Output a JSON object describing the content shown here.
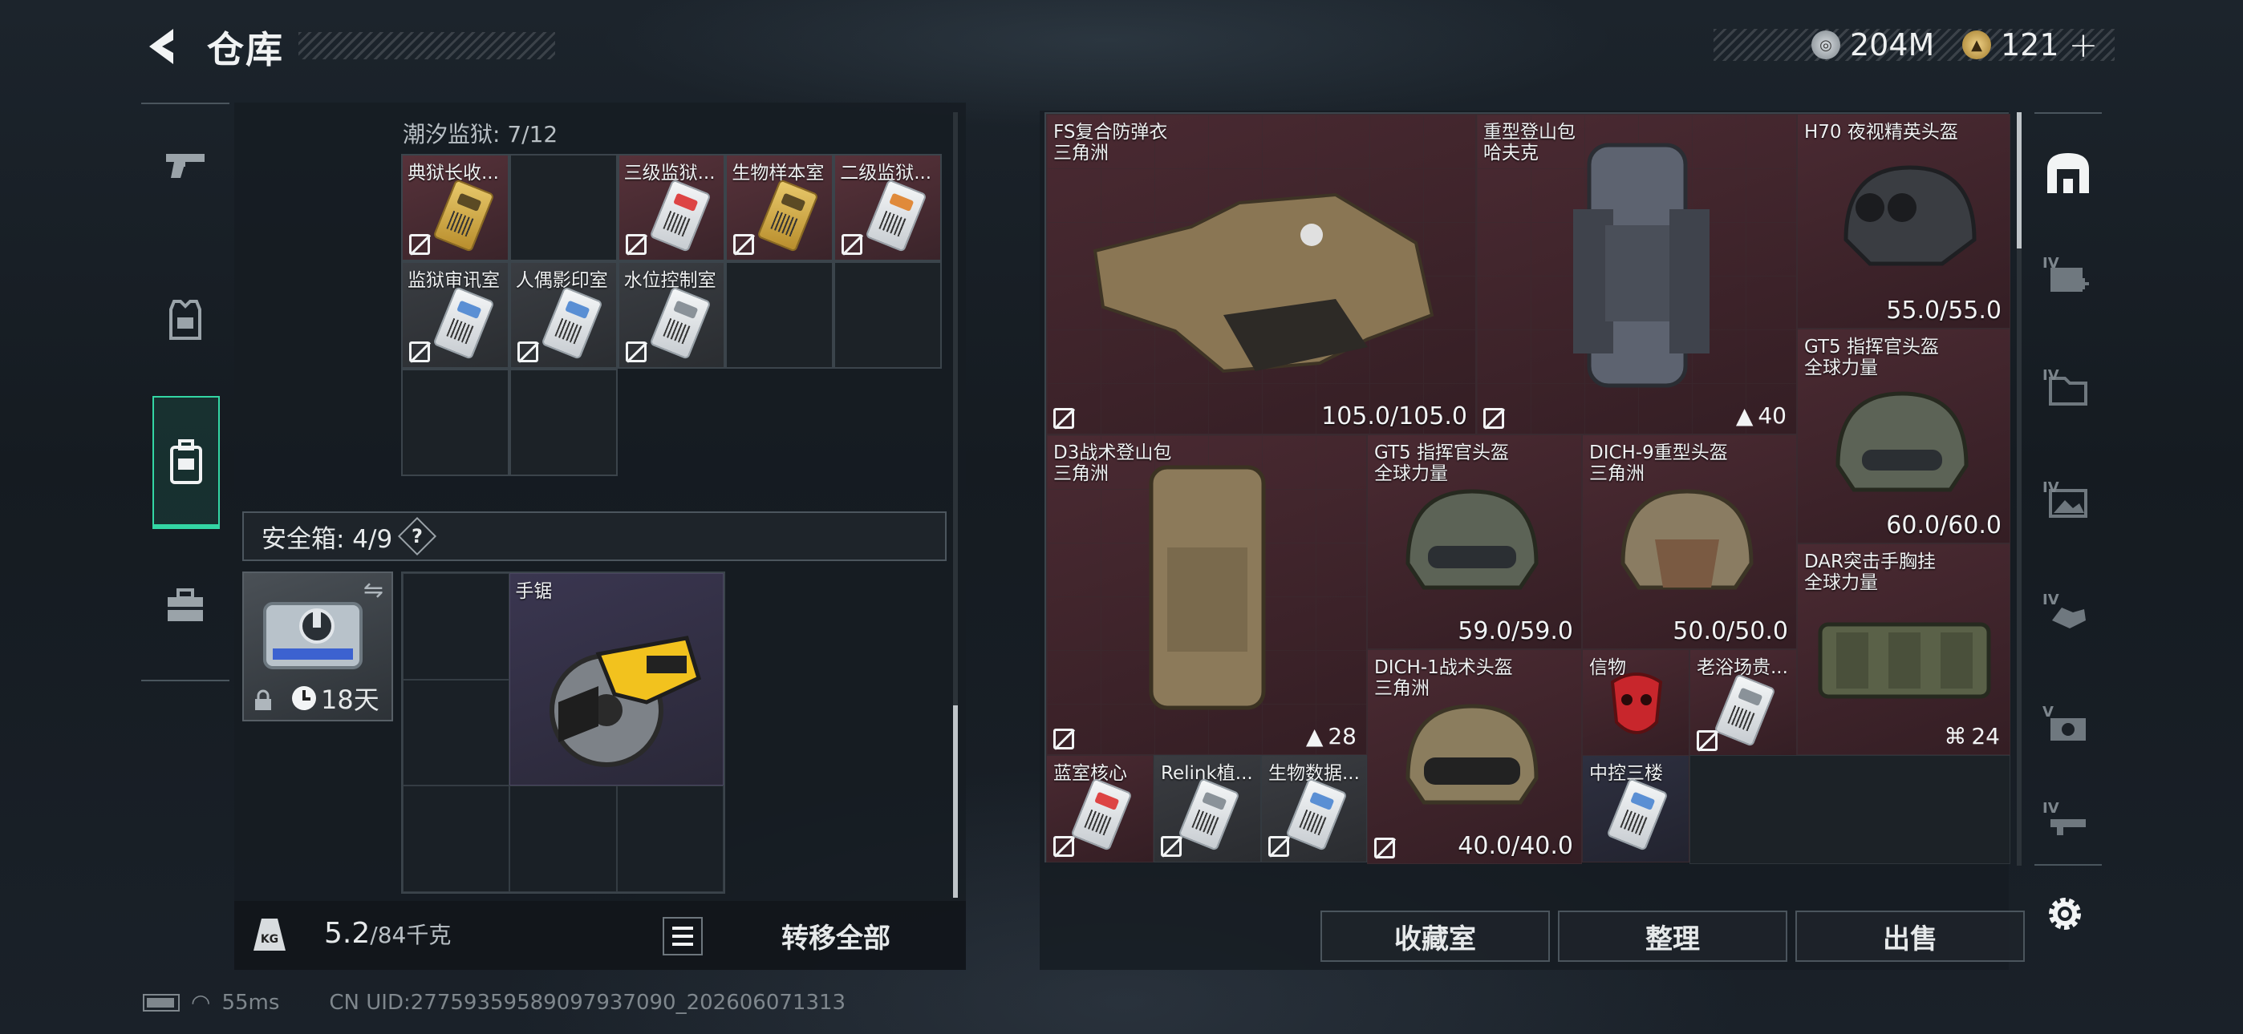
{
  "header": {
    "title": "仓库",
    "silver": "204M",
    "gold": "121"
  },
  "left_nav": [
    {
      "name": "weapons"
    },
    {
      "name": "equipment"
    },
    {
      "name": "backpack"
    },
    {
      "name": "toolbox"
    }
  ],
  "prison_section": {
    "title": "潮汐监狱: 7/12",
    "items": [
      "典狱长收...",
      "三级监狱...",
      "生物样本室",
      "二级监狱...",
      "监狱审讯室",
      "人偶影印室",
      "水位控制室"
    ]
  },
  "safe_box": {
    "label": "安全箱: 4/9",
    "help": "?",
    "timer": "18天",
    "item_name": "手锯"
  },
  "bottom_bar": {
    "weight_icon": "KG",
    "weight_current": "5.2",
    "weight_max": "/84千克",
    "transfer_all": "转移全部"
  },
  "storage": {
    "items": [
      {
        "name": "FS复合防弹衣",
        "origin": "三角洲",
        "value": "105.0/105.0"
      },
      {
        "name": "重型登山包",
        "origin": "哈夫克",
        "value": "40"
      },
      {
        "name": "H70 夜视精英头盔",
        "origin": "",
        "value": "55.0/55.0"
      },
      {
        "name": "GT5 指挥官头盔",
        "origin": "全球力量",
        "value": "60.0/60.0"
      },
      {
        "name": "D3战术登山包",
        "origin": "三角洲",
        "value": "28"
      },
      {
        "name": "GT5 指挥官头盔",
        "origin": "全球力量",
        "value": "59.0/59.0"
      },
      {
        "name": "DICH-9重型头盔",
        "origin": "三角洲",
        "value": "50.0/50.0"
      },
      {
        "name": "DAR突击手胸挂",
        "origin": "全球力量",
        "value": "24"
      },
      {
        "name": "DICH-1战术头盔",
        "origin": "三角洲",
        "value": "40.0/40.0"
      },
      {
        "name": "信物",
        "origin": "",
        "value": ""
      },
      {
        "name": "老浴场贵...",
        "origin": "",
        "value": ""
      },
      {
        "name": "蓝室核心",
        "origin": "",
        "value": ""
      },
      {
        "name": "Relink植...",
        "origin": "",
        "value": ""
      },
      {
        "name": "生物数据...",
        "origin": "",
        "value": ""
      },
      {
        "name": "中控三楼",
        "origin": "",
        "value": ""
      }
    ]
  },
  "actions": {
    "collection": "收藏室",
    "sort": "整理",
    "sell": "出售"
  },
  "right_nav": [
    {
      "name": "helmet-slot",
      "label": ""
    },
    {
      "name": "gear-iv-1",
      "label": "IV"
    },
    {
      "name": "gear-iv-2",
      "label": "IV"
    },
    {
      "name": "gear-iv-3",
      "label": "IV"
    },
    {
      "name": "gear-iv-4",
      "label": "IV"
    },
    {
      "name": "gear-v",
      "label": "V"
    },
    {
      "name": "gear-iv-5",
      "label": "IV"
    }
  ],
  "footer": {
    "ping": "55ms",
    "uid": "CN UID:27759359589097937090_202606071313"
  },
  "colors": {
    "accent": "#33d6a4",
    "item_red": "#4a2a32",
    "item_gray": "#3a3c41"
  }
}
